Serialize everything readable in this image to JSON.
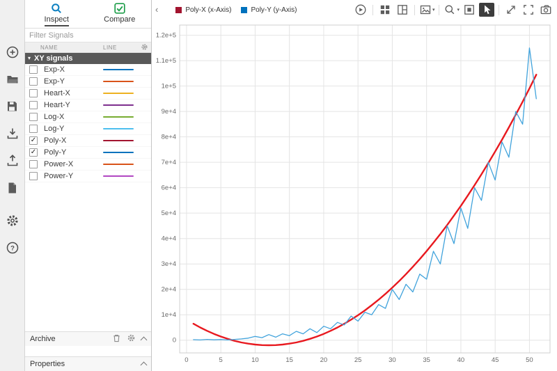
{
  "left_toolbar": {
    "icons": [
      "add",
      "open-folder",
      "save-session",
      "import",
      "export",
      "create-report",
      "preferences",
      "help"
    ]
  },
  "sidebar": {
    "tabs": [
      {
        "label": "Inspect",
        "active": true
      },
      {
        "label": "Compare",
        "active": false
      }
    ],
    "collapse_label": "‹",
    "filter_placeholder": "Filter Signals",
    "table": {
      "columns": [
        "NAME",
        "LINE"
      ],
      "group": {
        "label": "XY signals",
        "expanded": true,
        "triangle": "▾"
      },
      "rows": [
        {
          "name": "Exp-X",
          "checked": false,
          "color": "#0072BD"
        },
        {
          "name": "Exp-Y",
          "checked": false,
          "color": "#D95319"
        },
        {
          "name": "Heart-X",
          "checked": false,
          "color": "#EDB120"
        },
        {
          "name": "Heart-Y",
          "checked": false,
          "color": "#7E2F8E"
        },
        {
          "name": "Log-X",
          "checked": false,
          "color": "#77AC30"
        },
        {
          "name": "Log-Y",
          "checked": false,
          "color": "#4DBEEE"
        },
        {
          "name": "Poly-X",
          "checked": true,
          "color": "#A2142F"
        },
        {
          "name": "Poly-Y",
          "checked": true,
          "color": "#0072BD"
        },
        {
          "name": "Power-X",
          "checked": false,
          "color": "#D95319"
        },
        {
          "name": "Power-Y",
          "checked": false,
          "color": "#B146C2"
        }
      ],
      "check_glyph": "✓"
    },
    "archive": {
      "label": "Archive"
    },
    "properties": {
      "label": "Properties"
    }
  },
  "plot_header": {
    "legend": [
      {
        "label": "Poly-X (x-Axis)",
        "color": "#A2142F"
      },
      {
        "label": "Poly-Y (y-Axis)",
        "color": "#0072BD"
      }
    ],
    "toolbar_icons": [
      "run",
      "layout-grid",
      "layout-custom",
      "figure-menu",
      "zoom-menu",
      "fit-to-view",
      "pointer",
      "maximize",
      "fullscreen",
      "snapshot"
    ],
    "active_tool": "pointer",
    "caret": "▾"
  },
  "chart_data": {
    "type": "line",
    "title": "",
    "xlabel": "",
    "ylabel": "",
    "grid": true,
    "legend_position": "toolbar-top-left",
    "xlim": [
      -1,
      53
    ],
    "ylim": [
      -5000,
      124000
    ],
    "x_ticks": [
      0,
      5,
      10,
      15,
      20,
      25,
      30,
      35,
      40,
      45,
      50
    ],
    "x_tick_labels": [
      "0",
      "5",
      "10",
      "15",
      "20",
      "25",
      "30",
      "35",
      "40",
      "45",
      "50"
    ],
    "y_ticks": [
      0,
      10000,
      20000,
      30000,
      40000,
      50000,
      60000,
      70000,
      80000,
      90000,
      100000,
      110000,
      120000
    ],
    "y_tick_labels": [
      "0",
      "1e+4",
      "2e+4",
      "3e+4",
      "4e+4",
      "5e+4",
      "6e+4",
      "7e+4",
      "8e+4",
      "9e+4",
      "1e+5",
      "1.1e+5",
      "1.2e+5"
    ],
    "x": [
      1,
      2,
      3,
      4,
      5,
      6,
      7,
      8,
      9,
      10,
      11,
      12,
      13,
      14,
      15,
      16,
      17,
      18,
      19,
      20,
      21,
      22,
      23,
      24,
      25,
      26,
      27,
      28,
      29,
      30,
      31,
      32,
      33,
      34,
      35,
      36,
      37,
      38,
      39,
      40,
      41,
      42,
      43,
      44,
      45,
      46,
      47,
      48,
      49,
      50,
      51
    ],
    "series": [
      {
        "name": "Poly-X (x-Axis)",
        "legend_color": "#A2142F",
        "color": "#e8191f",
        "width": 2.4,
        "values": [
          6470,
          5000,
          3670,
          2480,
          1430,
          520,
          -250,
          -880,
          -1370,
          -1720,
          -1930,
          -2000,
          -1930,
          -1720,
          -1370,
          -880,
          -250,
          520,
          1430,
          2480,
          3670,
          5000,
          6470,
          8080,
          9830,
          11720,
          13750,
          15920,
          18230,
          20680,
          23270,
          26000,
          28870,
          31880,
          35030,
          38320,
          41750,
          45320,
          49030,
          52880,
          56870,
          61000,
          65270,
          69680,
          74230,
          78920,
          83750,
          88720,
          93830,
          99080,
          104470
        ]
      },
      {
        "name": "Poly-Y (y-Axis)",
        "legend_color": "#0072BD",
        "color": "#41a3dc",
        "width": 1.3,
        "values": [
          200,
          100,
          300,
          150,
          250,
          100,
          300,
          500,
          800,
          1500,
          1000,
          2200,
          1200,
          2500,
          1800,
          3500,
          2500,
          4500,
          3000,
          5500,
          4500,
          7000,
          6000,
          9500,
          7500,
          11000,
          10000,
          14000,
          12500,
          20000,
          16000,
          22000,
          19000,
          26000,
          24000,
          35000,
          30000,
          45000,
          38000,
          52000,
          44000,
          60000,
          55000,
          70000,
          63000,
          78000,
          72000,
          90000,
          85000,
          115000,
          95000
        ]
      }
    ]
  }
}
